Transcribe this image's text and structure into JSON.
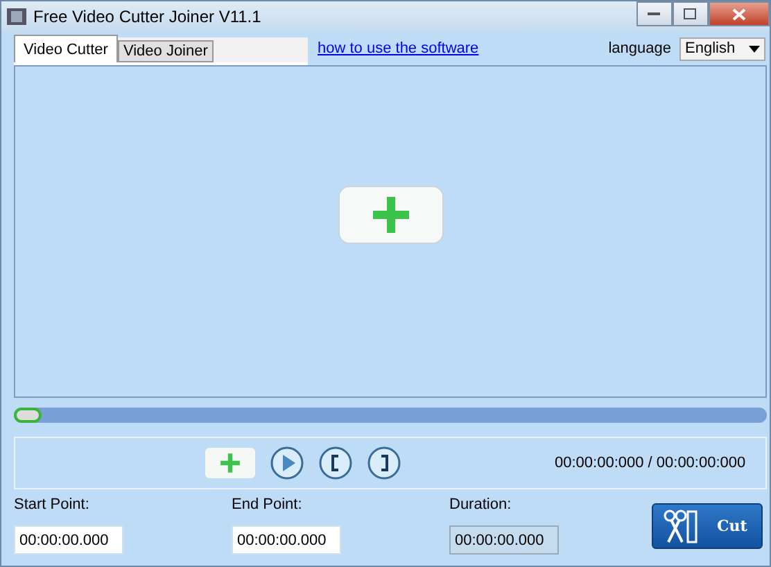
{
  "window": {
    "title": "Free Video Cutter Joiner V11.1"
  },
  "tabs": [
    {
      "label": "Video Cutter",
      "selected": true
    },
    {
      "label": "Video Joiner",
      "selected": false
    }
  ],
  "help_link": "how to use the software",
  "language": {
    "label": "language",
    "value": "English"
  },
  "seek_slider": {
    "level": 0
  },
  "time_display": "00:00:00:000 / 00:00:00:000",
  "fields": [
    {
      "label": "Start Point:",
      "value": "00:00:00.000",
      "disabled": false
    },
    {
      "label": "End Point:",
      "value": "00:00:00.000",
      "disabled": false
    },
    {
      "label": "Duration:",
      "value": "00:00:00.000",
      "disabled": true
    }
  ],
  "cut_button": "Cut"
}
